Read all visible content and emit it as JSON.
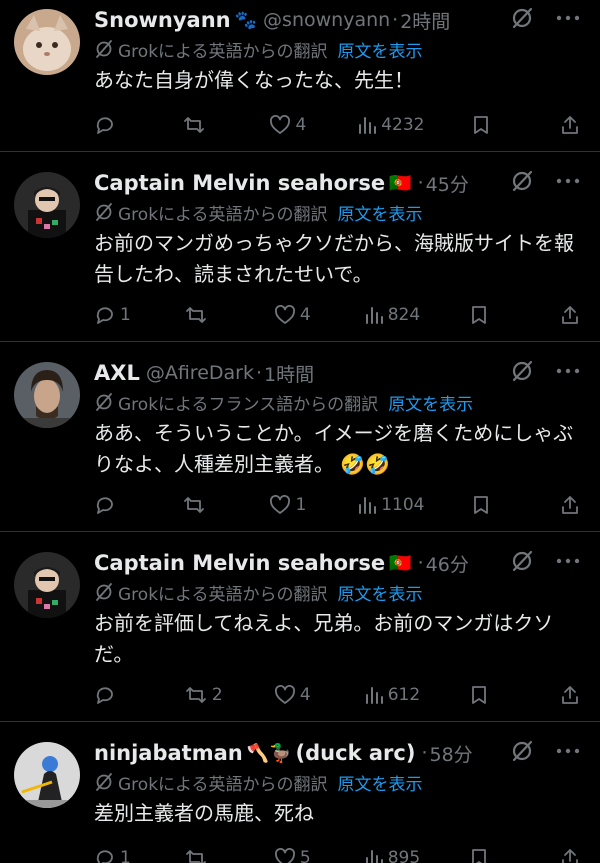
{
  "posts": [
    {
      "name": "Snownyann",
      "name_emoji": "🐾",
      "handle": "@snownyann",
      "time": "2時間",
      "translate": "Grokによる英語からの翻訳",
      "show_original": "原文を表示",
      "text": "あなた自身が偉くなったな、先生！",
      "replies": "",
      "reposts": "",
      "likes": "4",
      "views": "4232"
    },
    {
      "name": "Captain Melvin seahorse",
      "name_emoji": "🇵🇹",
      "handle": "",
      "time": "45分",
      "translate": "Grokによる英語からの翻訳",
      "show_original": "原文を表示",
      "text": "お前のマンガめっちゃクソだから、海賊版サイトを報告したわ、読まされたせいで。",
      "replies": "1",
      "reposts": "",
      "likes": "4",
      "views": "824"
    },
    {
      "name": "AXL",
      "name_emoji": "",
      "handle": "@AfireDark",
      "time": "1時間",
      "translate": "Grokによるフランス語からの翻訳",
      "show_original": "原文を表示",
      "text": "ああ、そういうことか。イメージを磨くためにしゃぶりなよ、人種差別主義者。",
      "text_emoji": "🤣🤣",
      "replies": "",
      "reposts": "",
      "likes": "1",
      "views": "1104"
    },
    {
      "name": "Captain Melvin seahorse",
      "name_emoji": "🇵🇹",
      "handle": "",
      "time": "46分",
      "translate": "Grokによる英語からの翻訳",
      "show_original": "原文を表示",
      "text": "お前を評価してねえよ、兄弟。お前のマンガはクソだ。",
      "replies": "",
      "reposts": "2",
      "likes": "4",
      "views": "612"
    },
    {
      "name": "ninjabatman",
      "name_emoji": "🪓🦆",
      "name_suffix": "(duck arc)",
      "handle": "",
      "time": "58分",
      "translate": "Grokによる英語からの翻訳",
      "show_original": "原文を表示",
      "text": "差別主義者の馬鹿、死ね",
      "replies": "1",
      "reposts": "",
      "likes": "5",
      "views": "895"
    }
  ],
  "colors": {
    "background": "#000000",
    "text": "#e7e9ea",
    "muted": "#71767b",
    "link": "#1d9bf0",
    "divider": "#2f3336"
  },
  "icons": [
    "grok-icon",
    "more-icon",
    "translate-icon",
    "reply-icon",
    "repost-icon",
    "like-icon",
    "views-icon",
    "bookmark-icon",
    "share-icon"
  ]
}
